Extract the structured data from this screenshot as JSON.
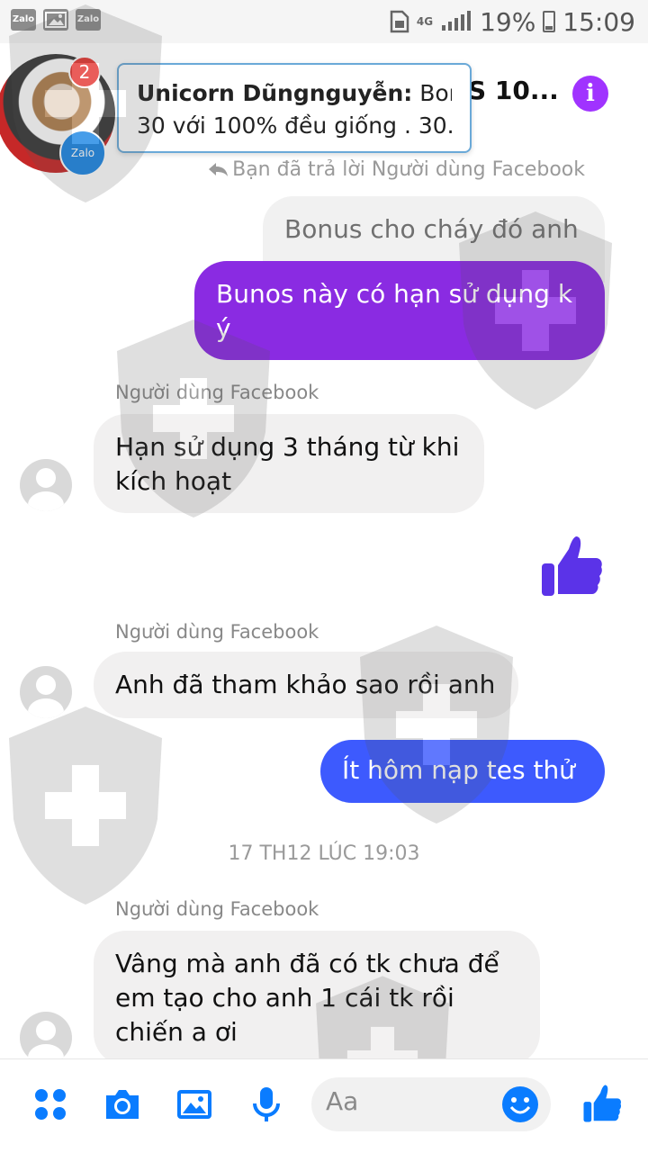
{
  "status_bar": {
    "left_icons": [
      "Zalo",
      "image-icon",
      "Zalo"
    ],
    "network": "4G",
    "battery": "19%",
    "time": "15:09"
  },
  "header": {
    "badge_count": "2",
    "chat_title": "S 10...",
    "zalo_label": "Zalo"
  },
  "notification": {
    "sender": "Unicorn Dũngnguyễn:",
    "text_line1": "Bonus",
    "text_line2": "30 với 100% đều giống . 30..."
  },
  "reply_note": "Bạn đã trả lời Người dùng Facebook",
  "messages": {
    "quoted": "Bonus cho cháy đó anh",
    "sent_purple": "Bunos  này  có hạn  sử dụng k ý",
    "sender1": "Người dùng Facebook",
    "recv1": "Hạn sử dụng 3 tháng từ khi kích hoạt",
    "sender2": "Người dùng Facebook",
    "recv2": "Anh đã tham khảo sao rồi anh",
    "sent_blue": "Ít hôm nạp tes  thử",
    "timestamp": "17 TH12 LÚC 19:03",
    "sender3": "Người dùng Facebook",
    "recv3": "Vâng mà anh đã có tk chưa để em tạo cho anh 1 cái tk rồi chiến a ơi"
  },
  "composer": {
    "placeholder": "Aa"
  },
  "colors": {
    "accent_purple": "#8a2be2",
    "accent_blue": "#3d5afe",
    "messenger_blue": "#0a7cff",
    "info_purple": "#a033ff"
  }
}
